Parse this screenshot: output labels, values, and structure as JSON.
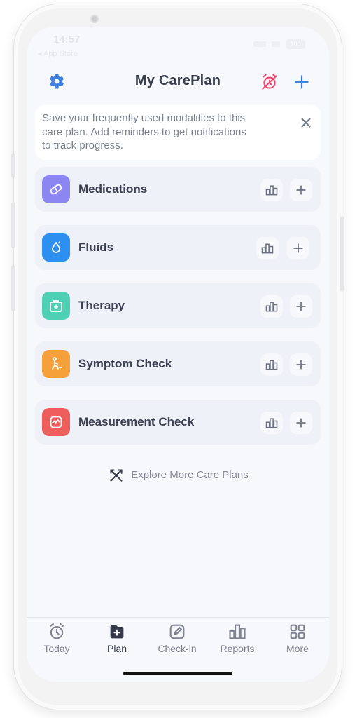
{
  "status": {
    "time": "14:57",
    "back_label": "◂ App Store",
    "battery": "100"
  },
  "header": {
    "title": "My CarePlan"
  },
  "banner": {
    "line1": "Save your frequently used modalities to this",
    "line2": "care plan. Add reminders to get notifications",
    "line3": "to track progress."
  },
  "items": [
    {
      "label": "Medications",
      "color": "#8b86f0",
      "icon": "pill-icon"
    },
    {
      "label": "Fluids",
      "color": "#2d8ff0",
      "icon": "droplet-icon"
    },
    {
      "label": "Therapy",
      "color": "#4fd0b4",
      "icon": "medkit-icon"
    },
    {
      "label": "Symptom Check",
      "color": "#f5a03a",
      "icon": "person-icon"
    },
    {
      "label": "Measurement Check",
      "color": "#f05d5d",
      "icon": "heartbeat-icon"
    }
  ],
  "explore": {
    "label": "Explore More Care Plans"
  },
  "tabs": [
    {
      "label": "Today",
      "icon": "alarm-clock-icon"
    },
    {
      "label": "Plan",
      "icon": "plan-icon",
      "active": true
    },
    {
      "label": "Check-in",
      "icon": "edit-icon"
    },
    {
      "label": "Reports",
      "icon": "bar-chart-icon"
    },
    {
      "label": "More",
      "icon": "grid-icon"
    }
  ],
  "colors": {
    "accent": "#3f7fe0",
    "alert": "#f0436a",
    "text": "#3a3f4e"
  }
}
